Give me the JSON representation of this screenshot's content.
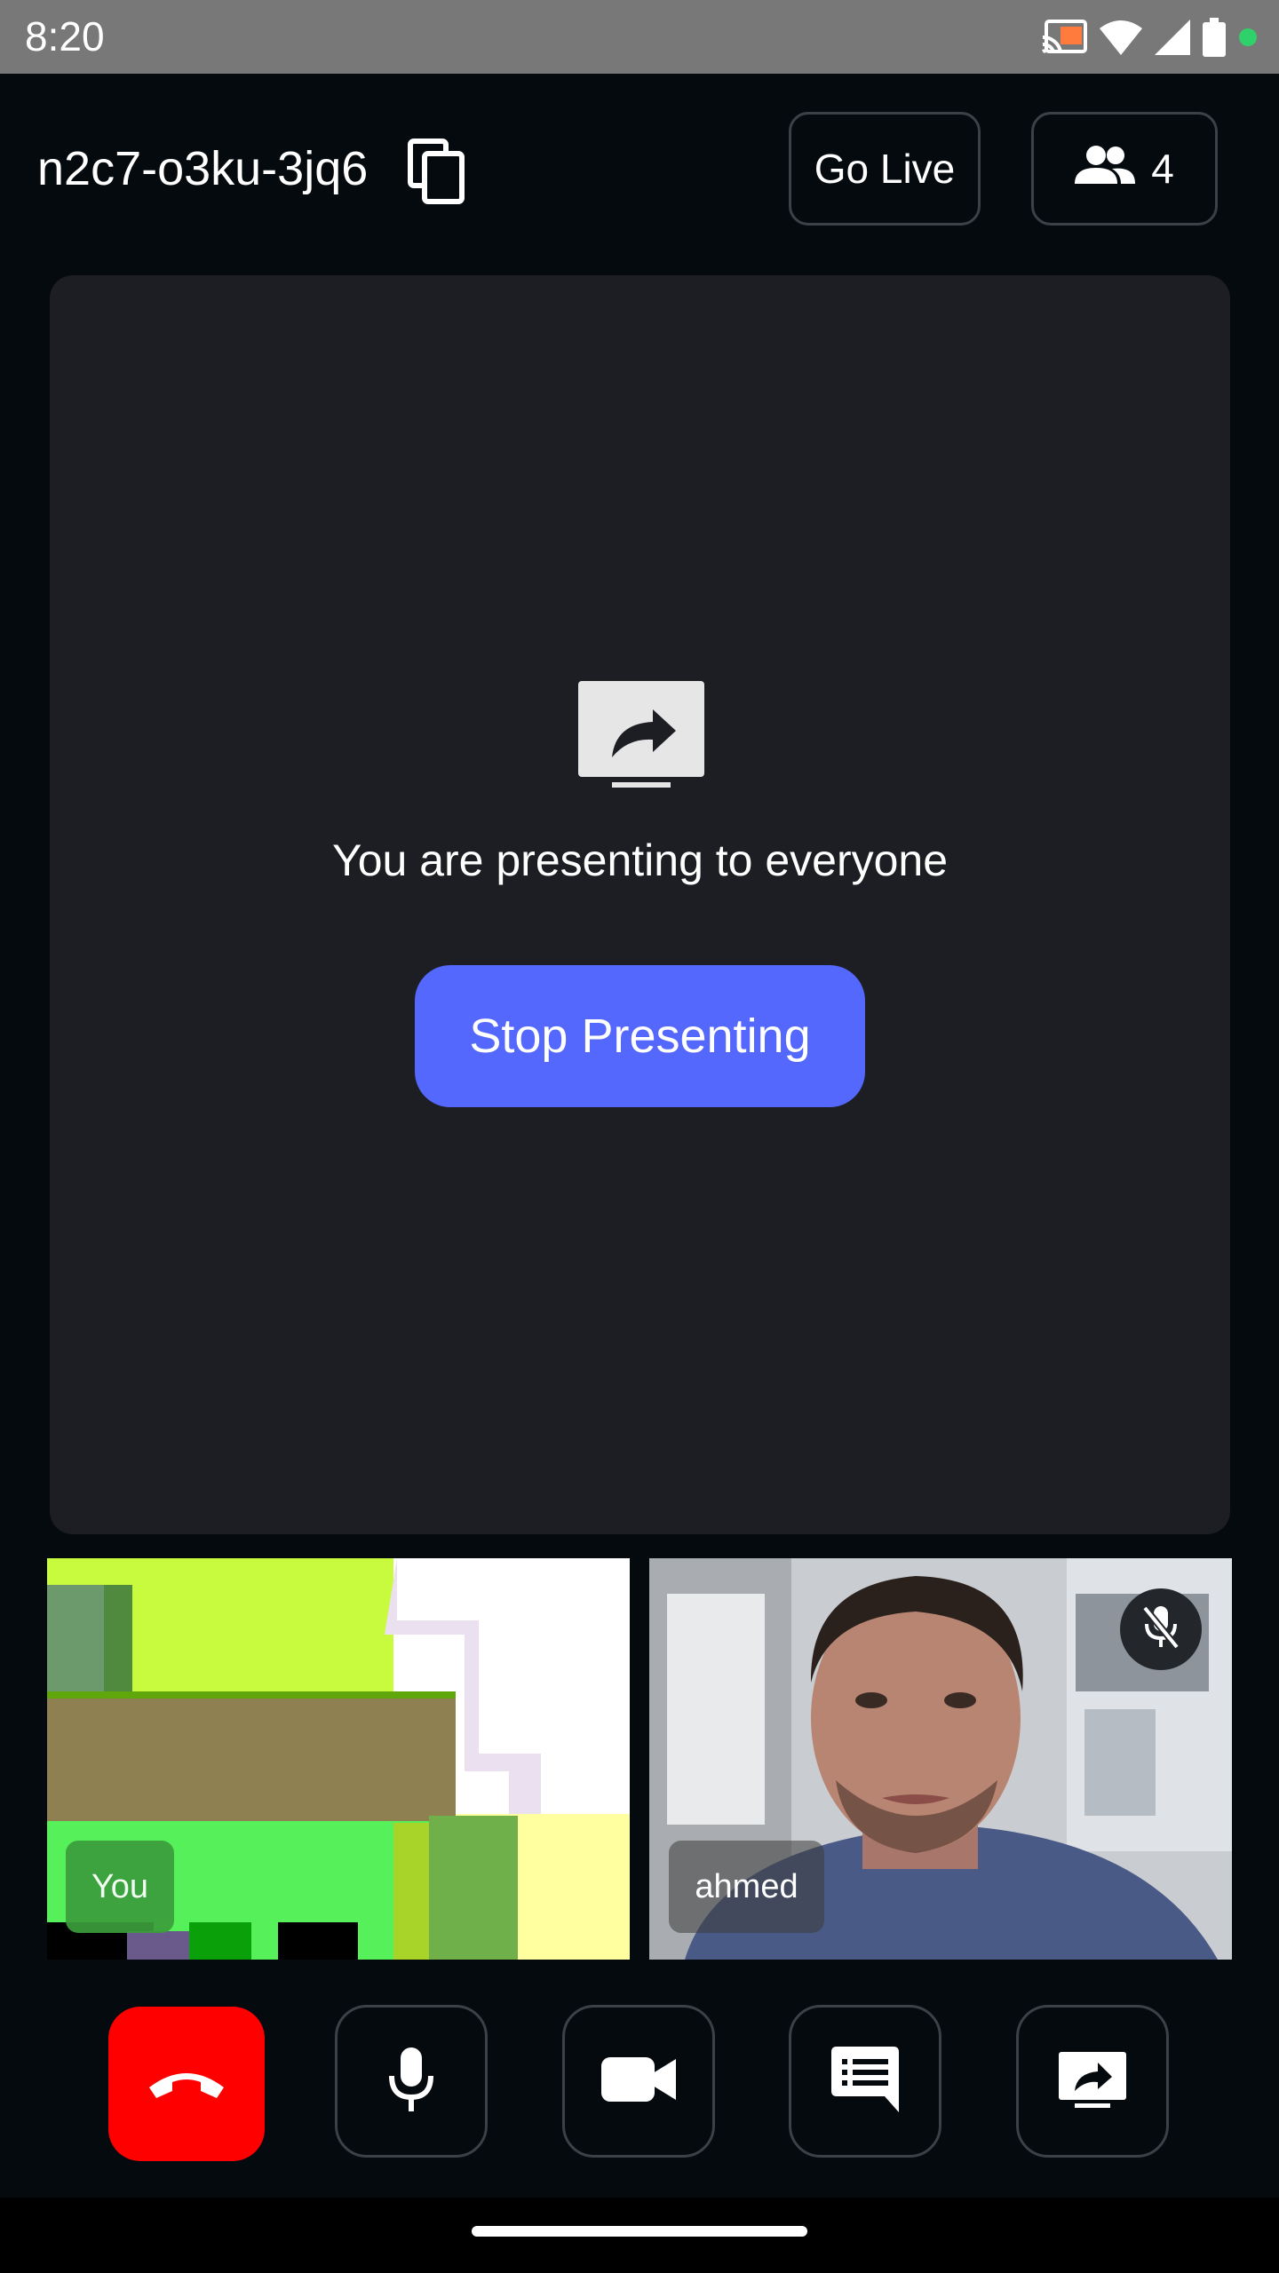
{
  "status_bar": {
    "time": "8:20",
    "icons": [
      "cast-icon",
      "wifi-icon",
      "signal-icon",
      "battery-icon",
      "privacy-dot-icon"
    ]
  },
  "header": {
    "meeting_id": "n2c7-o3ku-3jq6",
    "copy_icon": "copy-icon",
    "go_live_label": "Go Live",
    "participants_icon": "people-icon",
    "participants_count": "4"
  },
  "presentation": {
    "icon": "screen-share-icon",
    "message": "You are presenting to everyone",
    "stop_button_label": "Stop Presenting"
  },
  "participants": [
    {
      "name": "You",
      "mic_muted": false
    },
    {
      "name": "ahmed",
      "mic_muted": true
    }
  ],
  "controls": [
    {
      "name": "end-call",
      "icon": "phone-hangup-icon",
      "color": "#ff0000"
    },
    {
      "name": "microphone",
      "icon": "microphone-icon"
    },
    {
      "name": "camera",
      "icon": "video-camera-icon"
    },
    {
      "name": "chat",
      "icon": "chat-icon"
    },
    {
      "name": "screen-share",
      "icon": "screen-share-icon"
    }
  ],
  "colors": {
    "background": "#050a0e",
    "panel": "#1c1e23",
    "accent": "#5568fe",
    "end_call": "#ff0000",
    "status_bar": "#787878"
  }
}
